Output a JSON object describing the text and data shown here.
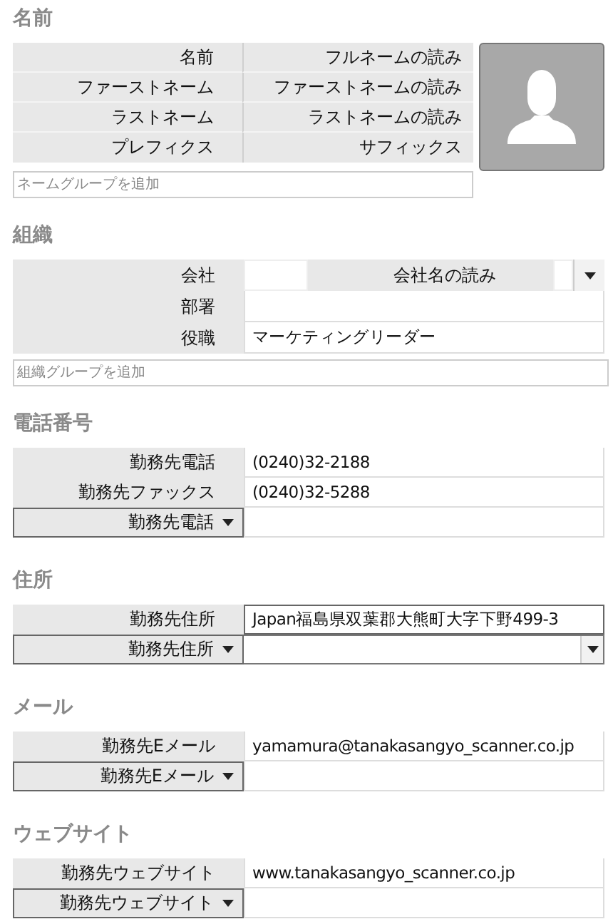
{
  "sections": [
    {
      "kind": "name",
      "title": "名前",
      "rows": [
        {
          "label": "名前",
          "reading": "フルネームの読み"
        },
        {
          "label": "ファーストネーム",
          "reading": "ファーストネームの読み"
        },
        {
          "label": "ラストネーム",
          "reading": "ラストネームの読み"
        },
        {
          "label": "プレフィクス",
          "reading": "サフィックス"
        }
      ],
      "group_placeholder": "ネームグループを追加"
    },
    {
      "kind": "organization",
      "title": "組織",
      "rows": [
        {
          "kind": "company",
          "label": "会社",
          "reading_label": "会社名の読み"
        },
        {
          "kind": "field",
          "label": "部署",
          "focused": false
        },
        {
          "kind": "field",
          "label": "役職",
          "value": "マーケティングリーダー",
          "focused": false
        }
      ],
      "group_placeholder": "組織グループを追加"
    },
    {
      "kind": "list",
      "title": "電話番号",
      "rows": [
        {
          "kind": "field",
          "label": "勤務先電話",
          "value": "(0240)32-2188",
          "focused": false
        },
        {
          "kind": "field",
          "label": "勤務先ファックス",
          "value": "(0240)32-5288",
          "focused": false
        },
        {
          "kind": "add",
          "label": "勤務先電話"
        }
      ]
    },
    {
      "kind": "list",
      "title": "住所",
      "rows": [
        {
          "kind": "field",
          "label": "勤務先住所",
          "value": "Japan福島県双葉郡大熊町大字下野499-3",
          "focused": true
        },
        {
          "kind": "add-select",
          "label": "勤務先住所"
        }
      ]
    },
    {
      "kind": "list",
      "title": "メール",
      "rows": [
        {
          "kind": "field",
          "label": "勤務先Eメール",
          "value": "yamamura@tanakasangyo_scanner.co.jp",
          "focused": false
        },
        {
          "kind": "add",
          "label": "勤務先Eメール"
        }
      ]
    },
    {
      "kind": "list",
      "title": "ウェブサイト",
      "rows": [
        {
          "kind": "field",
          "label": "勤務先ウェブサイト",
          "value": "www.tanakasangyo_scanner.co.jp",
          "focused": false
        },
        {
          "kind": "add",
          "label": "勤務先ウェブサイト"
        }
      ]
    }
  ]
}
